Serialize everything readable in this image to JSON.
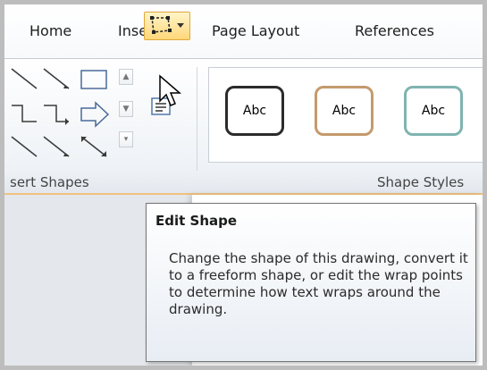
{
  "tabs": [
    "Home",
    "Insert",
    "Page Layout",
    "References"
  ],
  "groups": {
    "insert_shapes_label": "sert Shapes",
    "shape_styles_label": "Shape Styles"
  },
  "shape_styles": {
    "items": [
      {
        "label": "Abc",
        "border": "#2b2b2b"
      },
      {
        "label": "Abc",
        "border": "#c49a6c"
      },
      {
        "label": "Abc",
        "border": "#7fb4b0"
      }
    ]
  },
  "tooltip": {
    "title": "Edit Shape",
    "body": "Change the shape of this drawing, convert it to a freeform shape, or edit the wrap points to determine how text wraps around the drawing."
  },
  "colors": {
    "highlight": "#ffd77a",
    "ribbon_border": "#f1c27d"
  }
}
